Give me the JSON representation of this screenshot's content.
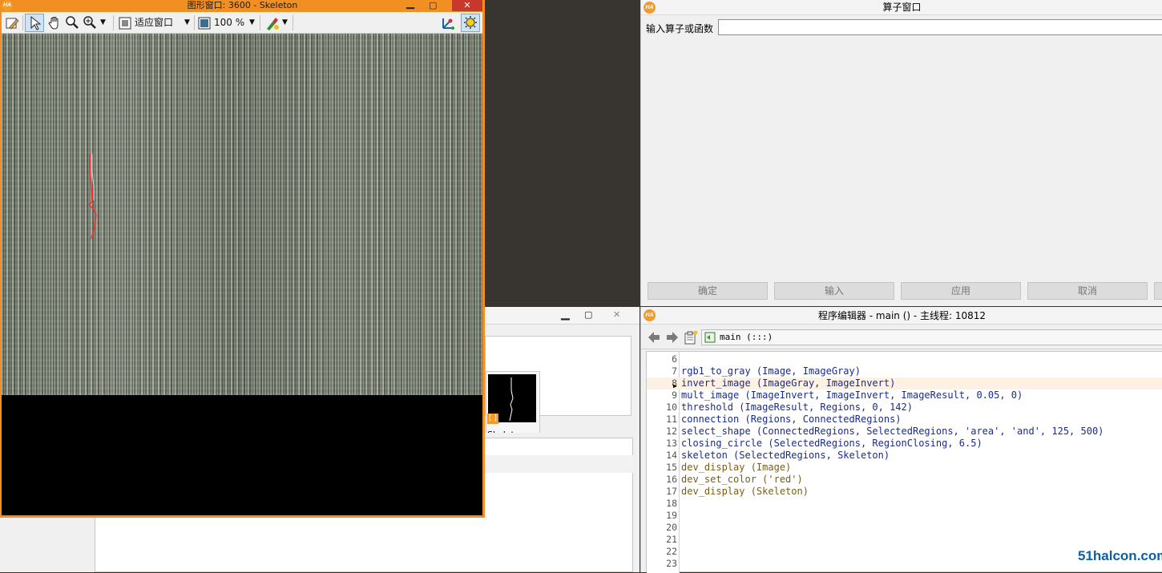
{
  "graphics_window": {
    "title": "图形窗口: 3600 - Skeleton",
    "zoom_mode": "适应窗口",
    "zoom_percent": "100 %"
  },
  "operator_window": {
    "title": "算子窗口",
    "input_label": "输入算子或函数",
    "input_value": "",
    "buttons": [
      "确定",
      "输入",
      "应用",
      "取消"
    ]
  },
  "program_editor": {
    "title": "程序编辑器 - main () - 主线程: 10812",
    "procedure": "main (:::)",
    "current_line": "8",
    "lines": [
      {
        "n": "6",
        "code": "",
        "kind": "op"
      },
      {
        "n": "7",
        "code": "rgb1_to_gray (Image, ImageGray)",
        "kind": "op"
      },
      {
        "n": "8",
        "code": "invert_image (ImageGray, ImageInvert)",
        "kind": "op"
      },
      {
        "n": "9",
        "code": "mult_image (ImageInvert, ImageInvert, ImageResult, 0.05, 0)",
        "kind": "op"
      },
      {
        "n": "10",
        "code": "threshold (ImageResult, Regions, 0, 142)",
        "kind": "op"
      },
      {
        "n": "11",
        "code": "connection (Regions, ConnectedRegions)",
        "kind": "op"
      },
      {
        "n": "12",
        "code": "select_shape (ConnectedRegions, SelectedRegions, 'area', 'and', 125, 500)",
        "kind": "op"
      },
      {
        "n": "13",
        "code": "closing_circle (SelectedRegions, RegionClosing, 6.5)",
        "kind": "op"
      },
      {
        "n": "14",
        "code": "skeleton (SelectedRegions, Skeleton)",
        "kind": "op"
      },
      {
        "n": "15",
        "code": "dev_display (Image)",
        "kind": "ctl"
      },
      {
        "n": "16",
        "code": "dev_set_color ('red')",
        "kind": "ctl"
      },
      {
        "n": "17",
        "code": "dev_display (Skeleton)",
        "kind": "ctl"
      },
      {
        "n": "18",
        "code": "",
        "kind": "op"
      },
      {
        "n": "19",
        "code": "",
        "kind": "op"
      },
      {
        "n": "20",
        "code": "",
        "kind": "op"
      },
      {
        "n": "21",
        "code": "",
        "kind": "op"
      },
      {
        "n": "22",
        "code": "",
        "kind": "op"
      },
      {
        "n": "23",
        "code": "",
        "kind": "op"
      }
    ]
  },
  "variable_window": {
    "thumbnail_label": "Skeleton"
  },
  "watermark": "51halcon.com",
  "colors": {
    "graphics_frame": "#f18f23",
    "operator_code": "#1a2b8c",
    "control_code": "#7a5c1a",
    "skeleton_overlay": "#ff2a2a"
  }
}
